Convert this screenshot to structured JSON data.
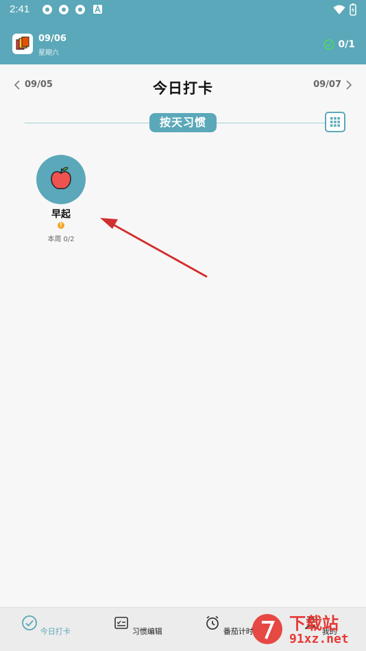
{
  "status_bar": {
    "time": "2:41",
    "icons": [
      "app-icon",
      "app-icon",
      "app-icon",
      "a-notification-icon",
      "wifi-icon",
      "battery-icon"
    ]
  },
  "header": {
    "date": "09/06",
    "weekday": "星期六",
    "progress": "0/1"
  },
  "date_nav": {
    "prev": "09/05",
    "title": "今日打卡",
    "next": "09/07"
  },
  "mode": {
    "label": "按天习惯"
  },
  "habits": [
    {
      "name": "早起",
      "icon": "apple-icon",
      "week": "本周 0/2"
    }
  ],
  "tabs": [
    {
      "label": "今日打卡",
      "icon": "check-circle-icon",
      "active": true
    },
    {
      "label": "习惯编辑",
      "icon": "edit-list-icon",
      "active": false
    },
    {
      "label": "番茄计时",
      "icon": "alarm-clock-icon",
      "active": false
    },
    {
      "label": "我的",
      "icon": "user-icon",
      "active": false
    }
  ],
  "watermark": {
    "text_top": "下载站",
    "text_bottom": "91xz.net"
  },
  "colors": {
    "accent": "#5aa8b9",
    "warning": "#f5a623",
    "arrow": "#d32f2f"
  }
}
